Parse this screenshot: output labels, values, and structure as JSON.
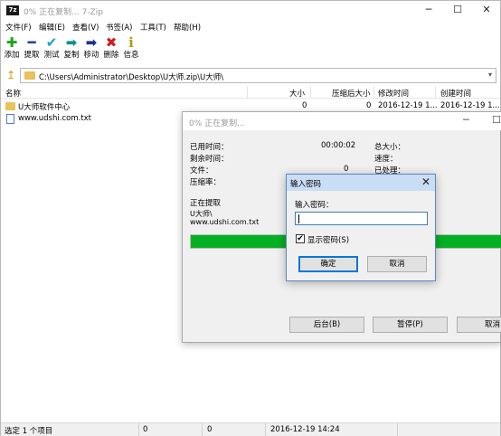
{
  "window": {
    "app_icon": "7z",
    "title": "0% 正在复制... 7-Zip",
    "controls": {
      "minimize": "─",
      "maximize": "☐",
      "close": "✕"
    }
  },
  "menu": [
    "文件(F)",
    "编辑(E)",
    "查看(V)",
    "书签(A)",
    "工具(T)",
    "帮助(H)"
  ],
  "toolbar": [
    {
      "label": "添加",
      "icon": "add-icon",
      "glyph": "✚",
      "color": "#1aa31a"
    },
    {
      "label": "提取",
      "icon": "extract-icon",
      "glyph": "━",
      "color": "#1f3fb3"
    },
    {
      "label": "测试",
      "icon": "test-icon",
      "glyph": "✔",
      "color": "#1aa0c8"
    },
    {
      "label": "复制",
      "icon": "copy-icon",
      "glyph": "➡",
      "color": "#138f8f"
    },
    {
      "label": "移动",
      "icon": "move-icon",
      "glyph": "➡",
      "color": "#1f2f8f"
    },
    {
      "label": "删除",
      "icon": "delete-icon",
      "glyph": "✖",
      "color": "#d01c1c"
    },
    {
      "label": "信息",
      "icon": "info-icon",
      "glyph": "ℹ",
      "color": "#b59a00"
    }
  ],
  "address": {
    "up_icon": "↥",
    "path": "C:\\Users\\Administrator\\Desktop\\U大师.zip\\U大师\\",
    "dropdown": "▾"
  },
  "columns": [
    "名称",
    "大小",
    "压缩后大小",
    "修改时间",
    "创建时间"
  ],
  "files": [
    {
      "name": "U大师软件中心",
      "type": "folder",
      "size": "0",
      "packed": "0",
      "modified": "2016-12-19 1...",
      "created": "2016-12-19 1..."
    },
    {
      "name": "www.udshi.com.txt",
      "type": "txt",
      "size": "",
      "packed": "",
      "modified": "",
      "created": ""
    }
  ],
  "statusbar": {
    "selected": "选定 1 个项目",
    "size": "0",
    "packed": "0",
    "time": "2016-12-19 14:24"
  },
  "progress": {
    "title": "0% 正在复制...",
    "controls": {
      "minimize": "─",
      "maximize": "☐"
    },
    "elapsed_label": "已用时间：",
    "elapsed": "00:00:02",
    "remaining_label": "剩余时间：",
    "files_label": "文件：",
    "files": "0",
    "ratio_label": "压缩率：",
    "total_label": "总大小：",
    "speed_label": "速度：",
    "processed_label": "已处理：",
    "action": "正在提取",
    "current_folder": "U大师\\",
    "current_file": "www.udshi.com.txt",
    "fill_fraction": 1.0,
    "btn_background": "后台(B)",
    "btn_pause": "暂停(P)",
    "btn_cancel": "取消"
  },
  "password_dialog": {
    "title": "输入密码",
    "close": "✕",
    "label": "输入密码：",
    "value": "",
    "show_password": "显示密码(S)",
    "show_checked": "✔",
    "ok": "确定",
    "cancel": "取消"
  }
}
